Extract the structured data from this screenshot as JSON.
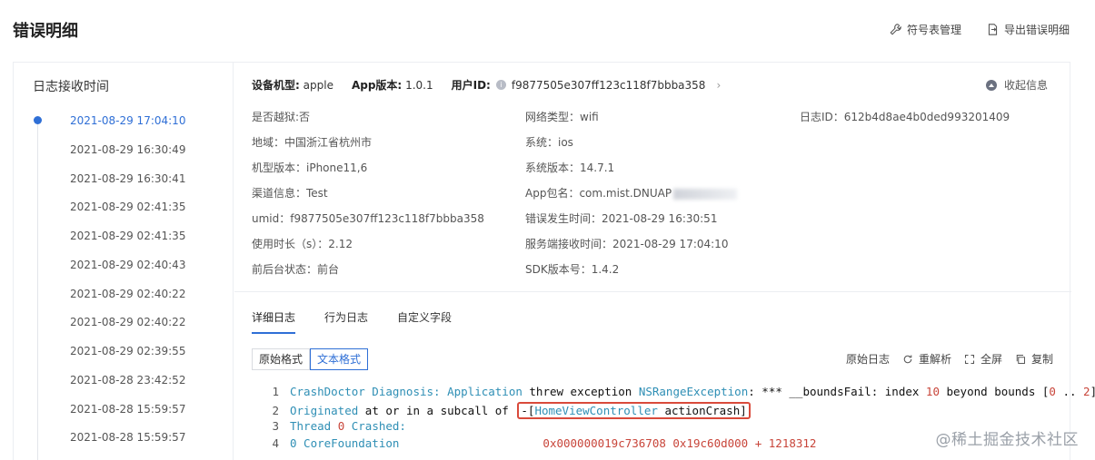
{
  "page": {
    "title": "错误明细"
  },
  "top_actions": [
    {
      "label": "符号表管理",
      "icon": "wrench-icon"
    },
    {
      "label": "导出错误明细",
      "icon": "export-icon"
    }
  ],
  "sidebar": {
    "title": "日志接收时间",
    "items": [
      {
        "label": "2021-08-29 17:04:10",
        "active": true
      },
      {
        "label": "2021-08-29 16:30:49"
      },
      {
        "label": "2021-08-29 16:30:41"
      },
      {
        "label": "2021-08-29 02:41:35"
      },
      {
        "label": "2021-08-29 02:41:35"
      },
      {
        "label": "2021-08-29 02:40:43"
      },
      {
        "label": "2021-08-29 02:40:22"
      },
      {
        "label": "2021-08-29 02:40:22"
      },
      {
        "label": "2021-08-29 02:39:55"
      },
      {
        "label": "2021-08-28 23:42:52"
      },
      {
        "label": "2021-08-28 15:59:57"
      },
      {
        "label": "2021-08-28 15:59:57"
      }
    ]
  },
  "info_header": {
    "device_label": "设备机型:",
    "device_value": "apple",
    "app_version_label": "App版本:",
    "app_version_value": "1.0.1",
    "user_id_label": "用户ID:",
    "user_id_value": "f9877505e307ff123c118f7bbba358",
    "chevron": "›",
    "collapse_label": "收起信息"
  },
  "info": {
    "col1": [
      "是否越狱:否",
      "地域：中国浙江省杭州市",
      "机型版本：iPhone11,6",
      "渠道信息：Test",
      "umid：f9877505e307ff123c118f7bbba358",
      "使用时长（s）：2.12",
      "前后台状态：前台"
    ],
    "col2": [
      "网络类型：wifi",
      "系统：ios",
      "系统版本：14.7.1",
      "App包名：com.mist.DNUAP",
      "错误发生时间：2021-08-29 16:30:51",
      "服务端接收时间：2021-08-29 17:04:10",
      "SDK版本号：1.4.2"
    ],
    "col3": [
      "日志ID：612b4d8ae4b0ded993201409"
    ]
  },
  "tabs": [
    {
      "label": "详细日志",
      "active": true
    },
    {
      "label": "行为日志"
    },
    {
      "label": "自定义字段"
    }
  ],
  "format_buttons": [
    {
      "label": "原始格式"
    },
    {
      "label": "文本格式",
      "active": true
    }
  ],
  "tools": [
    {
      "label": "原始日志",
      "icon": ""
    },
    {
      "label": "重解析",
      "icon": "refresh-icon"
    },
    {
      "label": "全屏",
      "icon": "fullscreen-icon"
    },
    {
      "label": "复制",
      "icon": "copy-icon"
    }
  ],
  "code": {
    "line_numbers": [
      "1",
      "2",
      "3",
      "4"
    ],
    "l1": {
      "a": "CrashDoctor Diagnosis: Application ",
      "b": "threw exception ",
      "c": "NSRangeException",
      "d": ": *** __boundsFail: index ",
      "e": "10",
      "f": " beyond bounds [",
      "g": "0",
      "h": " .. ",
      "i": "2",
      "j": "]"
    },
    "l2": {
      "a": "Originated ",
      "b": "at or in a subcall of ",
      "c": "-[",
      "d": "HomeViewController ",
      "e": "actionCrash]"
    },
    "l3": {
      "a": "Thread ",
      "b": "0",
      "c": " Crashed:"
    },
    "l4": {
      "a": "0    CoreFoundation",
      "b": "0x000000019c736708 0x19c60d000 + 1218312"
    }
  },
  "watermark": "@稀土掘金技术社区",
  "colors": {
    "accent": "#2f6fd6",
    "highlight_box": "#d94a3b",
    "code_blue": "#2f8fb5",
    "code_red": "#c8453a"
  }
}
